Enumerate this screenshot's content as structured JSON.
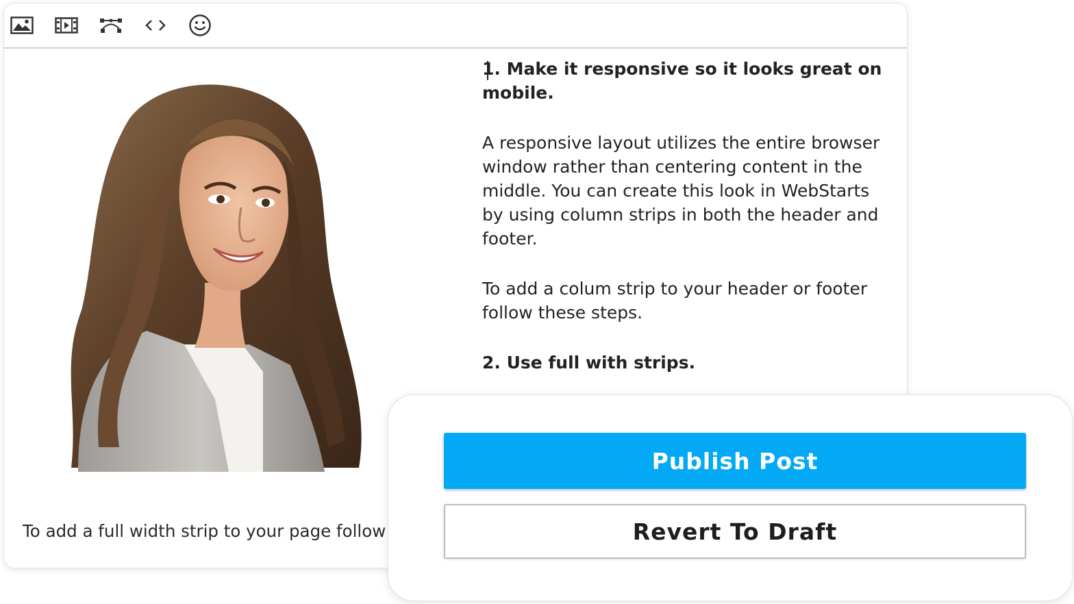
{
  "toolbar": {
    "tools": [
      {
        "icon": "image-icon"
      },
      {
        "icon": "video-icon"
      },
      {
        "icon": "vector-path-icon"
      },
      {
        "icon": "code-icon"
      },
      {
        "icon": "emoji-icon"
      }
    ]
  },
  "content": {
    "heading_1": "1. Make it responsive so it looks great on mobile.",
    "paragraph_1": "A responsive layout utilizes the entire browser window rather than centering content in the middle. You can create this look in WebStarts by using column strips in both the header and footer.",
    "paragraph_2": "To add a colum strip to your header or footer follow these steps.",
    "heading_2": "2. Use full with strips.",
    "caption": "To add a full width strip to your page follow"
  },
  "panel": {
    "publish_label": "Publish Post",
    "revert_label": "Revert To Draft",
    "publish_color": "#03a9f4"
  }
}
